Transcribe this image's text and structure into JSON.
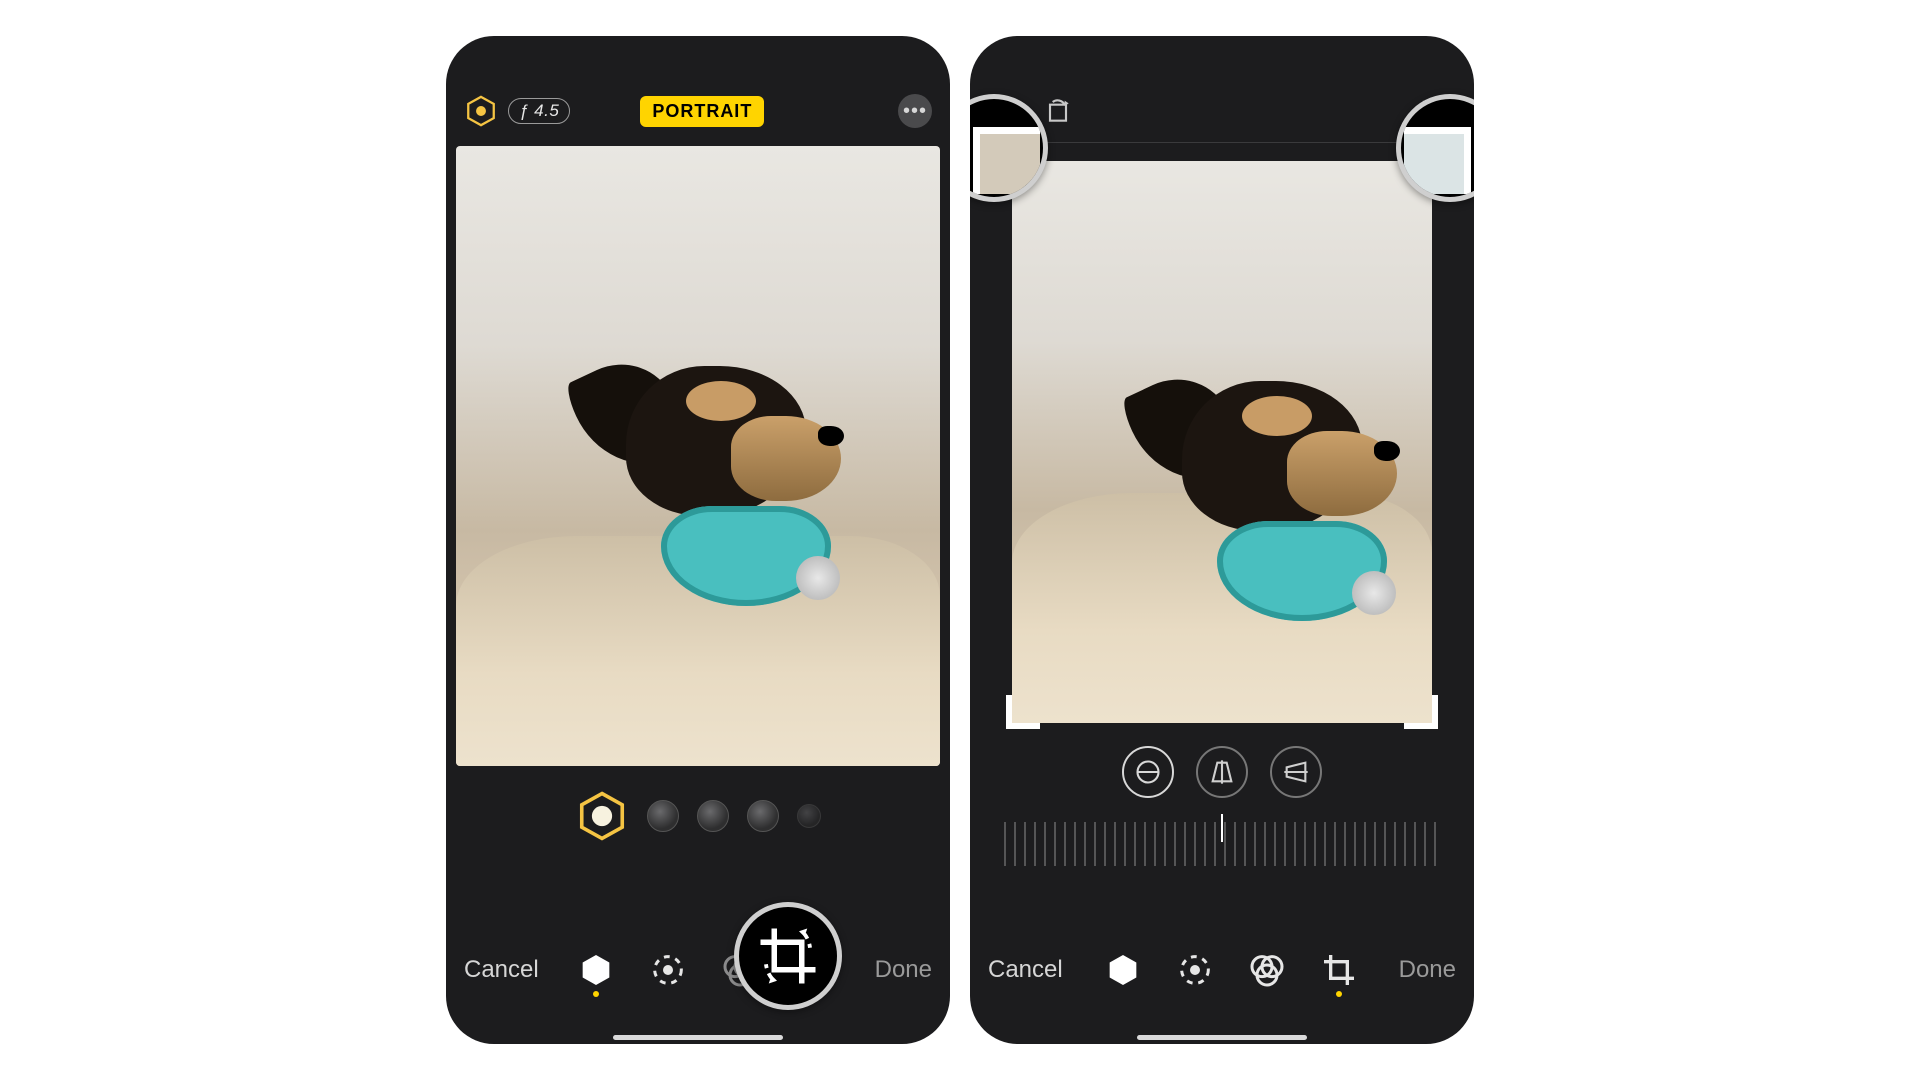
{
  "screen1": {
    "topbar": {
      "portraitLightingIcon": "hexagon-portrait-lighting-icon",
      "aperture": "ƒ 4.5",
      "modeBadge": "PORTRAIT",
      "moreLabel": "•••"
    },
    "lightingStyles": {
      "selectedIcon": "natural-light-icon",
      "extraDots": 3
    },
    "bottom": {
      "cancel": "Cancel",
      "done": "Done",
      "tools": {
        "portraitLighting": "portrait-lighting-tool",
        "adjust": "adjust-tool",
        "filters": "filters-tool",
        "crop": "crop-tool"
      },
      "activeTool": "portraitLighting"
    }
  },
  "screen2": {
    "topbar": {
      "flipIcon": "flip-horizontal-icon",
      "rotateIcon": "rotate-icon",
      "aspectIcon": "aspect-ratio-icon"
    },
    "cropModes": {
      "straighten": "straighten-icon",
      "vertical": "vertical-perspective-icon",
      "horizontal": "horizontal-perspective-icon",
      "selected": "straighten"
    },
    "bottom": {
      "cancel": "Cancel",
      "done": "Done",
      "tools": {
        "portraitLighting": "portrait-lighting-tool",
        "adjust": "adjust-tool",
        "filters": "filters-tool",
        "crop": "crop-tool"
      },
      "activeTool": "crop"
    }
  },
  "colors": {
    "accentYellow": "#ffd400",
    "textMuted": "#d6d6d6",
    "hexGold": "#f5c443"
  }
}
